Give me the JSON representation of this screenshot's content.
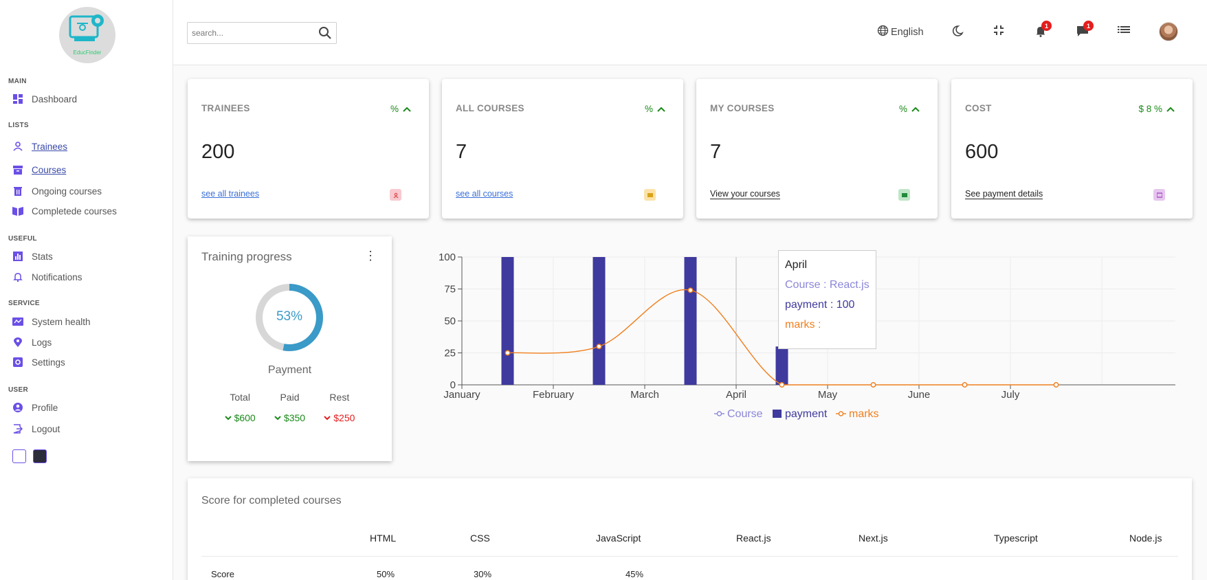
{
  "sidebar": {
    "logo_text": "EducFinder",
    "sections": [
      {
        "title": "MAIN"
      },
      {
        "title": "LISTS"
      },
      {
        "title": "USEFUL"
      },
      {
        "title": "SERVICE"
      },
      {
        "title": "USER"
      }
    ],
    "items": [
      {
        "label": "Dashboard",
        "icon": "dashboard-icon"
      },
      {
        "label": "Trainees",
        "icon": "user-icon"
      },
      {
        "label": "Courses",
        "icon": "archive-icon"
      },
      {
        "label": "Ongoing courses",
        "icon": "trash-bin-icon"
      },
      {
        "label": "Completede courses",
        "icon": "book-icon"
      },
      {
        "label": "Stats",
        "icon": "bar-chart-icon"
      },
      {
        "label": "Notifications",
        "icon": "bell-icon"
      },
      {
        "label": "System health",
        "icon": "monitor-icon"
      },
      {
        "label": "Logs",
        "icon": "location-icon"
      },
      {
        "label": "Settings",
        "icon": "gear-icon"
      },
      {
        "label": "Profile",
        "icon": "account-circle-icon"
      },
      {
        "label": "Logout",
        "icon": "logout-icon"
      }
    ],
    "accent_color": "#6b4fe6"
  },
  "header": {
    "search_placeholder": "search...",
    "language_label": "English",
    "notifications_count": "1",
    "messages_count": "1"
  },
  "cards": [
    {
      "title": "TRAINEES",
      "percent": "%",
      "value": "200",
      "link": "see all trainees",
      "icon_color": "#f8c9cf"
    },
    {
      "title": "ALL COURSES",
      "percent": "%",
      "value": "7",
      "link": "see all courses",
      "icon_color": "#fbe2a8"
    },
    {
      "title": "MY COURSES",
      "percent": "%",
      "value": "7",
      "link": "View your courses",
      "icon_color": "#bfe6c6"
    },
    {
      "title": "COST",
      "percent": "$ 8 %",
      "value": "600",
      "link": "See payment details",
      "icon_color": "#e6c6ef"
    }
  ],
  "progress": {
    "title": "Training progress",
    "percent_label": "53%",
    "percent_value": 53,
    "caption": "Payment",
    "headers": [
      "Total",
      "Paid",
      "Rest"
    ],
    "values": [
      "$600",
      "$350",
      "$250"
    ]
  },
  "chart_data": {
    "type": "bar",
    "x_labels": [
      "January",
      "February",
      "March",
      "April",
      "May",
      "June",
      "July"
    ],
    "ylim": [
      0,
      100
    ],
    "yticks": [
      0,
      25,
      50,
      75,
      100
    ],
    "series": [
      {
        "name": "Course",
        "kind": "line",
        "color": "#8b86d8"
      },
      {
        "name": "payment",
        "kind": "bar",
        "color": "#3f3a9e",
        "values": [
          100,
          100,
          100,
          30,
          0,
          0,
          0
        ]
      },
      {
        "name": "marks",
        "kind": "line",
        "color": "#f07f1e",
        "values": [
          25,
          30,
          74,
          0,
          0,
          0,
          0
        ]
      }
    ],
    "tooltip": {
      "title": "April",
      "course": "Course : React.js",
      "payment": "payment : 100",
      "marks": "marks :"
    }
  },
  "scores": {
    "title": "Score for completed courses",
    "columns": [
      "HTML",
      "CSS",
      "JavaScript",
      "React.js",
      "Next.js",
      "Typescript",
      "Node.js"
    ],
    "row_label": "Score",
    "values": [
      "50%",
      "30%",
      "45%"
    ]
  }
}
